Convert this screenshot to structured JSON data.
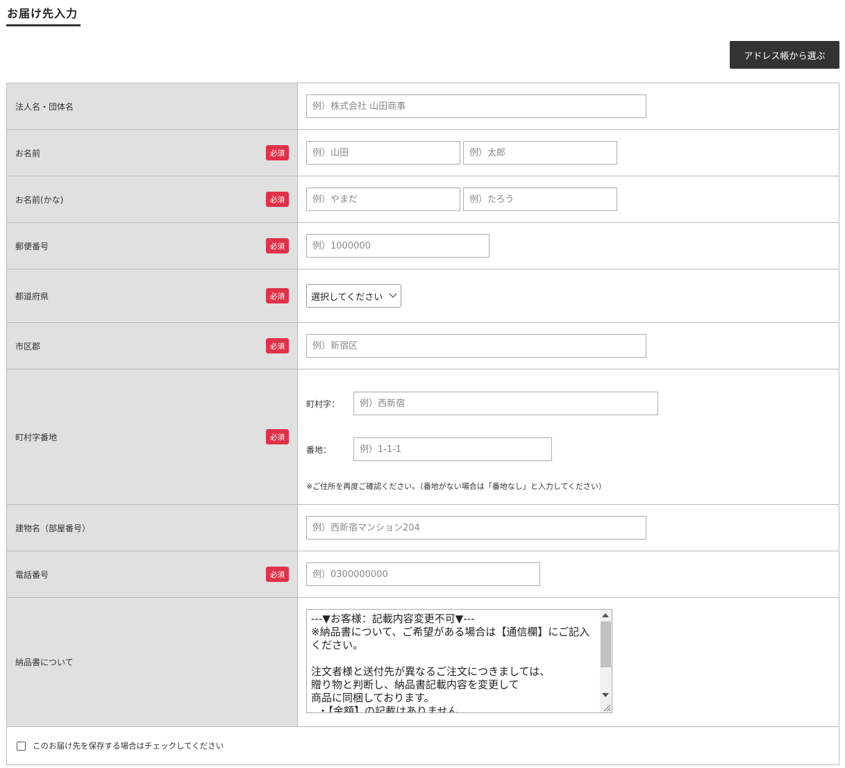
{
  "header": {
    "title": "お届け先入力",
    "address_book_button": "アドレス帳から選ぶ"
  },
  "form": {
    "required_label": "必須",
    "company": {
      "label": "法人名・団体名",
      "placeholder": "例）株式会社 山田商事"
    },
    "name": {
      "label": "お名前",
      "last_placeholder": "例）山田",
      "first_placeholder": "例）太郎"
    },
    "name_kana": {
      "label": "お名前(かな)",
      "last_placeholder": "例）やまだ",
      "first_placeholder": "例）たろう"
    },
    "postal": {
      "label": "郵便番号",
      "placeholder": "例）1000000"
    },
    "prefecture": {
      "label": "都道府県",
      "selected": "選択してください"
    },
    "city": {
      "label": "市区郡",
      "placeholder": "例）新宿区"
    },
    "street": {
      "label": "町村字番地",
      "town_label": "町村字：",
      "town_placeholder": "例）西新宿",
      "number_label": "番地：",
      "number_placeholder": "例）1-1-1",
      "note": "※ご住所を再度ご確認ください。（番地がない場合は「番地なし」と入力してください）"
    },
    "building": {
      "label": "建物名（部屋番号）",
      "placeholder": "例）西新宿マンション204"
    },
    "phone": {
      "label": "電話番号",
      "placeholder": "例）0300000000"
    },
    "invoice": {
      "label": "納品書について",
      "text": "---▼お客様：記載内容変更不可▼---\n※納品書について、ご希望がある場合は【通信欄】にご記入ください。\n\n注文者様と送付先が異なるご注文につきましては、\n贈り物と判断し、納品書記載内容を変更して\n商品に同梱しております。\n  ・【金額】の記載はありません"
    },
    "save_checkbox_label": "このお届け先を保存する場合はチェックしてください"
  }
}
